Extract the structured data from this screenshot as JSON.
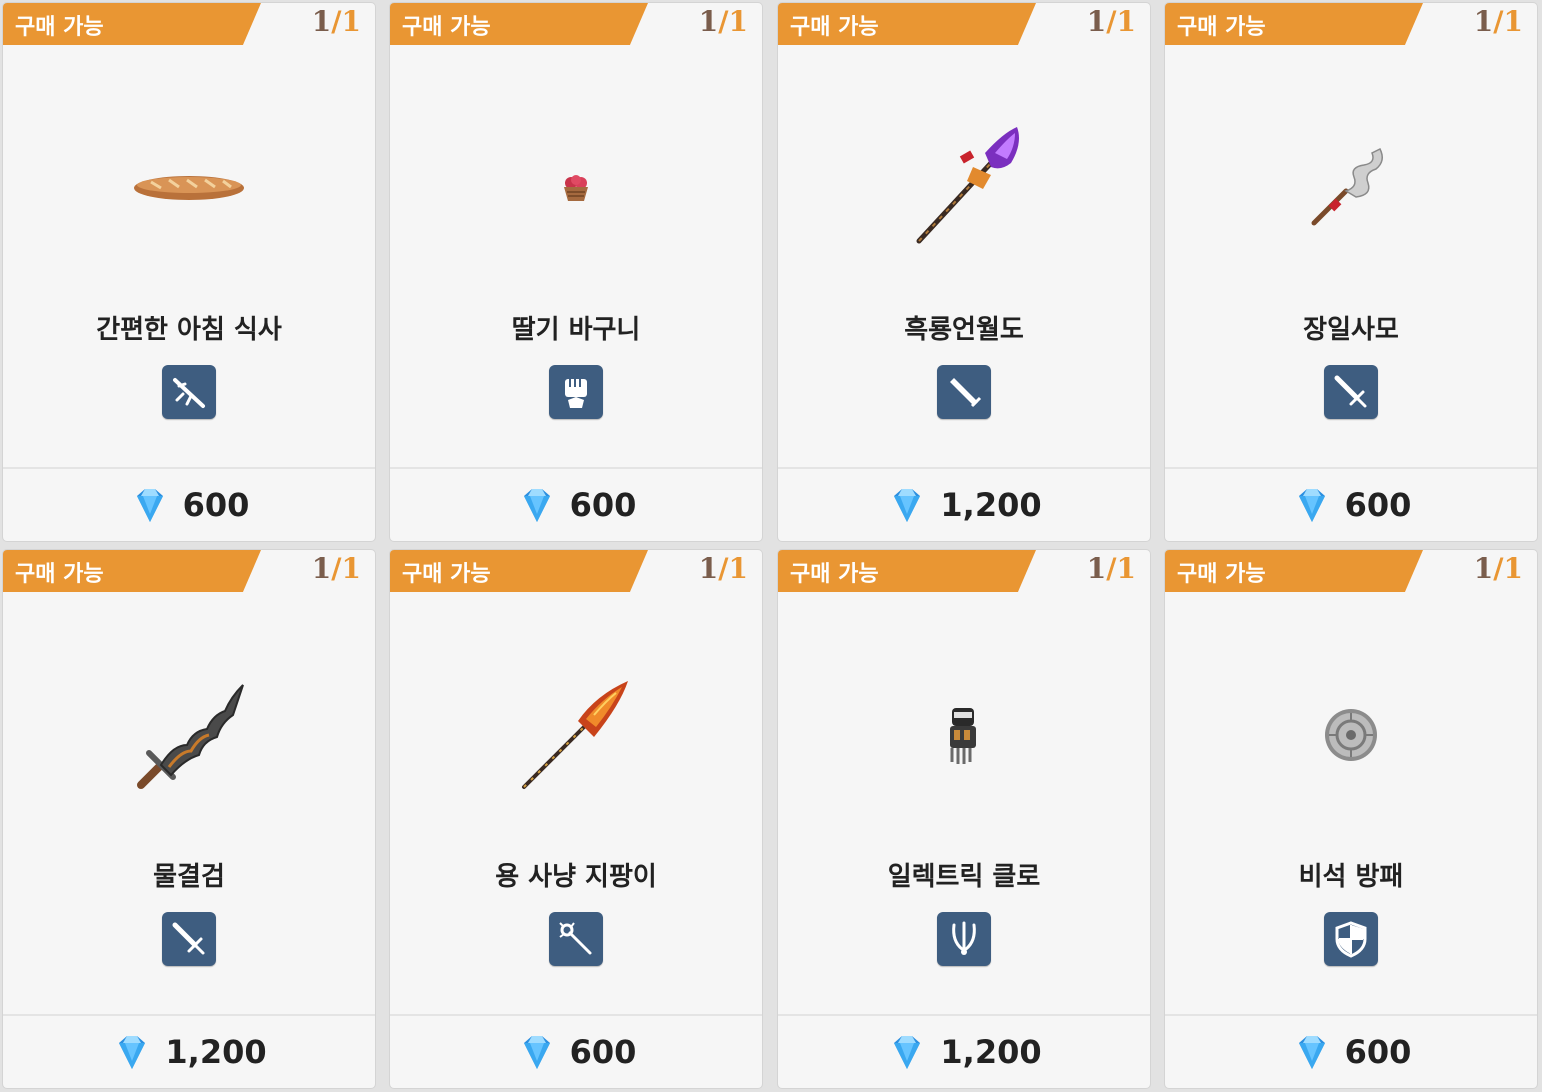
{
  "colors": {
    "badge": "#e99633",
    "type_icon_bg": "#3e5d80",
    "card_bg": "#f6f6f6",
    "gem": "#3aa8f0"
  },
  "items": [
    {
      "badge": "구매 가능",
      "stock_current": "1",
      "stock_sep": "/",
      "stock_max": "1",
      "name": "간편한 아침 식사",
      "price": "600",
      "art_icon": "baguette-icon",
      "type_icon": "rifle-icon"
    },
    {
      "badge": "구매 가능",
      "stock_current": "1",
      "stock_sep": "/",
      "stock_max": "1",
      "name": "딸기 바구니",
      "price": "600",
      "art_icon": "strawberry-basket-icon",
      "type_icon": "fist-icon"
    },
    {
      "badge": "구매 가능",
      "stock_current": "1",
      "stock_sep": "/",
      "stock_max": "1",
      "name": "흑룡언월도",
      "price": "1,200",
      "art_icon": "glaive-icon",
      "type_icon": "greatsword-icon"
    },
    {
      "badge": "구매 가능",
      "stock_current": "1",
      "stock_sep": "/",
      "stock_max": "1",
      "name": "장일사모",
      "price": "600",
      "art_icon": "snake-spear-icon",
      "type_icon": "sword-icon"
    },
    {
      "badge": "구매 가능",
      "stock_current": "1",
      "stock_sep": "/",
      "stock_max": "1",
      "name": "물결검",
      "price": "1,200",
      "art_icon": "wave-sword-icon",
      "type_icon": "sword-icon"
    },
    {
      "badge": "구매 가능",
      "stock_current": "1",
      "stock_sep": "/",
      "stock_max": "1",
      "name": "용 사냥 지팡이",
      "price": "600",
      "art_icon": "dragon-staff-icon",
      "type_icon": "staff-icon"
    },
    {
      "badge": "구매 가능",
      "stock_current": "1",
      "stock_sep": "/",
      "stock_max": "1",
      "name": "일렉트릭 클로",
      "price": "1,200",
      "art_icon": "claw-gauntlet-icon",
      "type_icon": "claw-icon"
    },
    {
      "badge": "구매 가능",
      "stock_current": "1",
      "stock_sep": "/",
      "stock_max": "1",
      "name": "비석 방패",
      "price": "600",
      "art_icon": "stone-shield-icon",
      "type_icon": "shield-icon"
    }
  ]
}
